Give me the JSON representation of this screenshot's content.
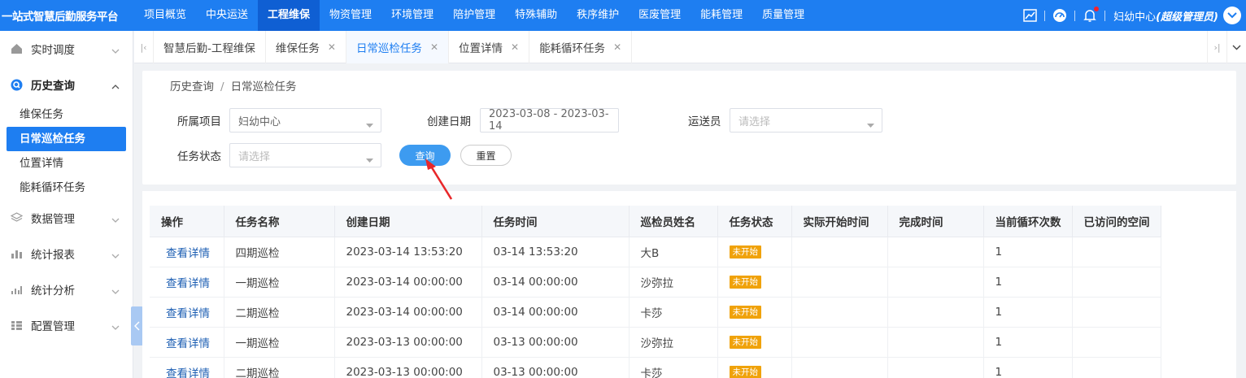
{
  "header": {
    "brand": "一站式智慧后勤服务平台",
    "nav": [
      "项目概览",
      "中央运送",
      "工程维保",
      "物资管理",
      "环境管理",
      "陪护管理",
      "特殊辅助",
      "秩序维护",
      "医废管理",
      "能耗管理",
      "质量管理"
    ],
    "active_nav": "工程维保",
    "user_org": "妇幼中心",
    "user_role": "(超级管理员)"
  },
  "sidebar": {
    "menus": [
      {
        "label": "实时调度",
        "icon": "home-icon"
      },
      {
        "label": "历史查询",
        "icon": "search-icon"
      },
      {
        "label": "数据管理",
        "icon": "layers-icon"
      },
      {
        "label": "统计报表",
        "icon": "bar-chart-icon"
      },
      {
        "label": "统计分析",
        "icon": "analysis-icon"
      },
      {
        "label": "配置管理",
        "icon": "config-icon"
      }
    ],
    "submenu": [
      "维保任务",
      "日常巡检任务",
      "位置详情",
      "能耗循环任务"
    ],
    "active_sub": "日常巡检任务"
  },
  "tabs": [
    {
      "label": "智慧后勤-工程维保",
      "closable": false
    },
    {
      "label": "维保任务",
      "closable": true
    },
    {
      "label": "日常巡检任务",
      "closable": true
    },
    {
      "label": "位置详情",
      "closable": true
    },
    {
      "label": "能耗循环任务",
      "closable": true
    }
  ],
  "breadcrumb": {
    "parent": "历史查询",
    "separator": "/",
    "current": "日常巡检任务"
  },
  "filters": {
    "project_label": "所属项目",
    "project_value": "妇幼中心",
    "date_label": "创建日期",
    "date_value": "2023-03-08 - 2023-03-14",
    "courier_label": "运送员",
    "courier_placeholder": "请选择",
    "status_label": "任务状态",
    "status_placeholder": "请选择",
    "query_button": "查询",
    "reset_button": "重置"
  },
  "table": {
    "columns": [
      "操作",
      "任务名称",
      "创建日期",
      "任务时间",
      "巡检员姓名",
      "任务状态",
      "实际开始时间",
      "完成时间",
      "当前循环次数",
      "已访问的空间"
    ],
    "rows": [
      {
        "action": "查看详情",
        "name": "四期巡检",
        "created": "2023-03-14 13:53:20",
        "time": "03-14 13:53:20",
        "inspector": "大B",
        "status": "未开始",
        "start": "",
        "finish": "",
        "cycles": "1",
        "visited": ""
      },
      {
        "action": "查看详情",
        "name": "一期巡检",
        "created": "2023-03-14 00:00:00",
        "time": "03-14 00:00:00",
        "inspector": "沙弥拉",
        "status": "未开始",
        "start": "",
        "finish": "",
        "cycles": "1",
        "visited": ""
      },
      {
        "action": "查看详情",
        "name": "二期巡检",
        "created": "2023-03-14 00:00:00",
        "time": "03-14 00:00:00",
        "inspector": "卡莎",
        "status": "未开始",
        "start": "",
        "finish": "",
        "cycles": "1",
        "visited": ""
      },
      {
        "action": "查看详情",
        "name": "一期巡检",
        "created": "2023-03-13 00:00:00",
        "time": "03-13 00:00:00",
        "inspector": "沙弥拉",
        "status": "未开始",
        "start": "",
        "finish": "",
        "cycles": "1",
        "visited": ""
      },
      {
        "action": "查看详情",
        "name": "二期巡检",
        "created": "2023-03-13 00:00:00",
        "time": "03-13 00:00:00",
        "inspector": "卡莎",
        "status": "未开始",
        "start": "",
        "finish": "",
        "cycles": "1",
        "visited": ""
      }
    ]
  },
  "colors": {
    "primary": "#1e7ef1",
    "badge": "#f0a20a",
    "annotation_arrow": "#e8272a"
  }
}
